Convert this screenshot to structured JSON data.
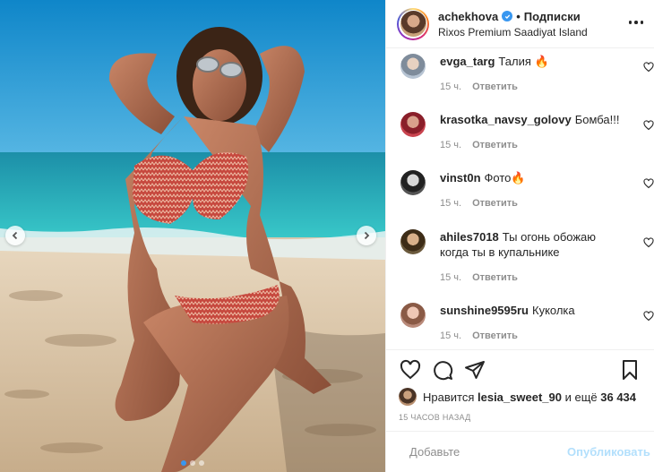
{
  "header": {
    "username": "achekhova",
    "follow_label": "Подписки",
    "location": "Rixos Premium Saadiyat Island",
    "separator": "•"
  },
  "comments": [
    {
      "username": "evga_targ",
      "text": "Талия 🔥",
      "time": "15 ч.",
      "reply_label": "Ответить",
      "avatar_color": "#b7c4d3"
    },
    {
      "username": "krasotka_navsy_golovy",
      "text": "Бомба!!!",
      "time": "15 ч.",
      "reply_label": "Ответить",
      "avatar_color": "#c9444f"
    },
    {
      "username": "vinst0n",
      "text": "Фото🔥",
      "time": "15 ч.",
      "reply_label": "Ответить",
      "avatar_color": "#3a3a3a"
    },
    {
      "username": "ahiles7018",
      "text": "Ты огонь обожаю когда ты в купальнике",
      "time": "15 ч.",
      "reply_label": "Ответить",
      "avatar_color": "#6b5a3d"
    },
    {
      "username": "sunshine9595ru",
      "text": "Куколка",
      "time": "15 ч.",
      "reply_label": "Ответить",
      "avatar_color": "#b98a7a"
    }
  ],
  "likes": {
    "prefix": "Нравится",
    "liked_by": "lesia_sweet_90",
    "suffix": "и ещё",
    "count": "36 434"
  },
  "timestamp": "15 часов назад",
  "add_comment": {
    "placeholder": "Добавьте комментарий...",
    "display": "Добавьте",
    "publish_label": "Опубликовать"
  },
  "carousel": {
    "dot_count": 3,
    "active_index": 0
  },
  "colors": {
    "accent": "#3897f0",
    "publish_disabled": "#b2dffc",
    "muted": "#8e8e8e",
    "text": "#262626"
  },
  "icons": [
    "heart-icon",
    "comment-icon",
    "share-icon",
    "bookmark-icon",
    "emoji-icon",
    "chevron-left-icon",
    "chevron-right-icon",
    "more-icon",
    "verified-icon"
  ]
}
